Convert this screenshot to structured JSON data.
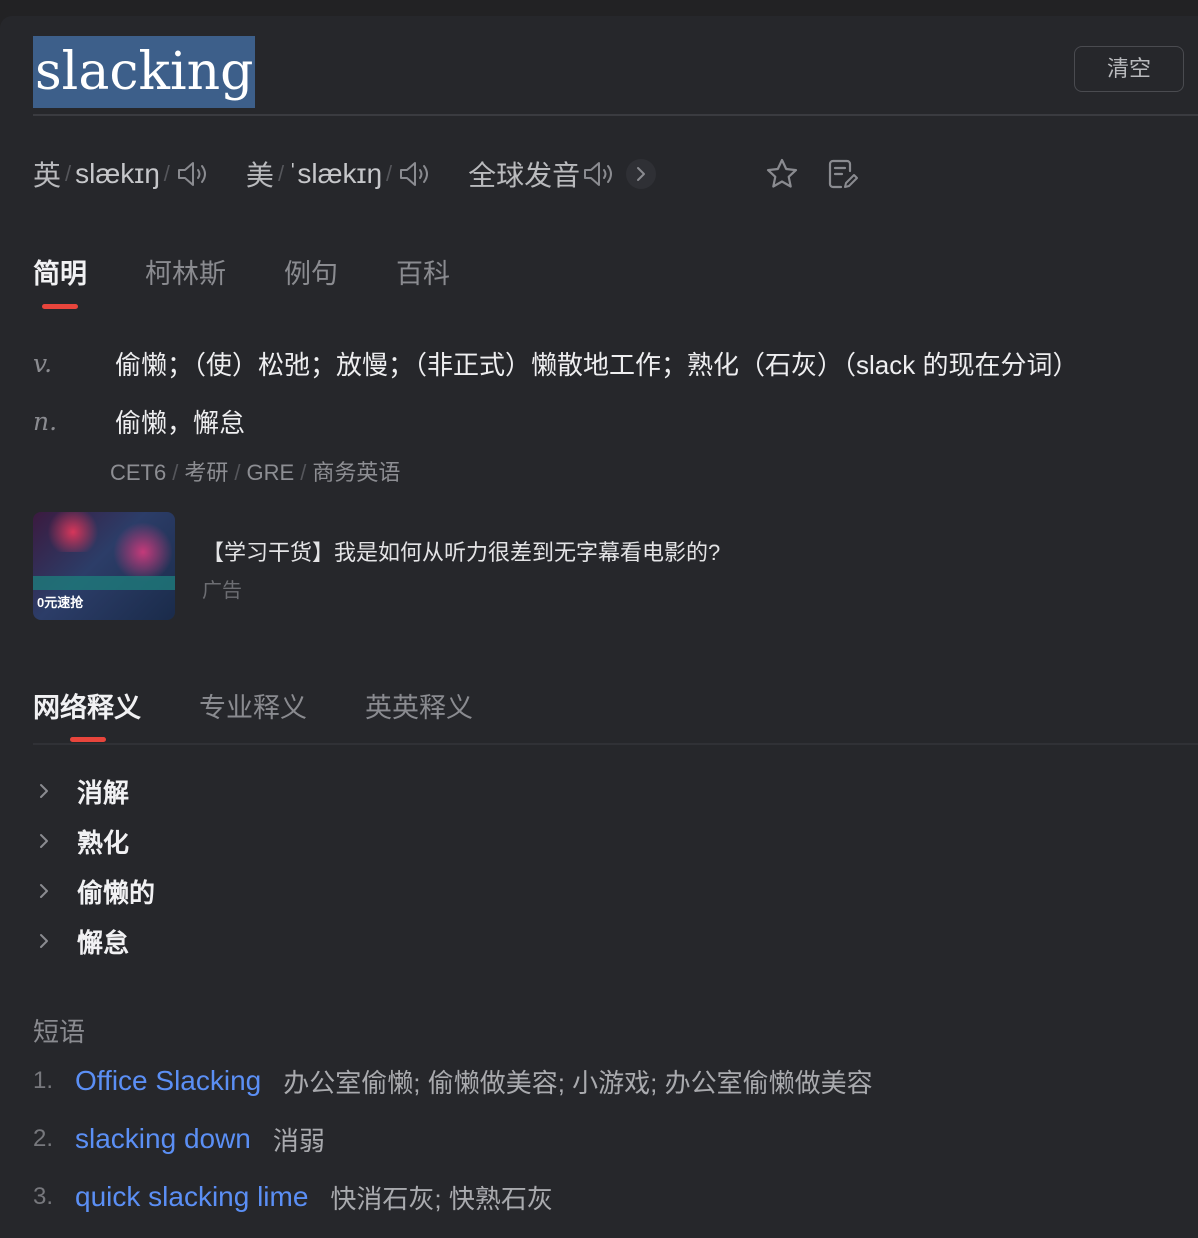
{
  "search": {
    "query": "slacking",
    "clear_label": "清空"
  },
  "pronunciation": {
    "uk_label": "英",
    "uk_phonetic": "slækɪŋ",
    "us_label": "美",
    "us_phonetic": "ˈslækɪŋ",
    "global_label": "全球发音",
    "sep": "/"
  },
  "tabs": [
    "简明",
    "柯林斯",
    "例句",
    "百科"
  ],
  "definitions": [
    {
      "pos": "v.",
      "meaning": "偷懒；（使）松弛；放慢；（非正式）懒散地工作；熟化（石灰）（slack 的现在分词）"
    },
    {
      "pos": "n.",
      "meaning": "偷懒，懈怠"
    }
  ],
  "exam_tags": [
    "CET6",
    "考研",
    "GRE",
    "商务英语"
  ],
  "ad": {
    "title": "【学习干货】我是如何从听力很差到无字幕看电影的?",
    "label": "广告",
    "thumb_text": "0元速抢"
  },
  "net_tabs": [
    "网络释义",
    "专业释义",
    "英英释义"
  ],
  "net_meanings": [
    "消解",
    "熟化",
    "偷懒的",
    "懈怠"
  ],
  "phrases_heading": "短语",
  "phrases": [
    {
      "num": "1.",
      "en": "Office Slacking",
      "zh": "办公室偷懒; 偷懒做美容; 小游戏; 办公室偷懒做美容"
    },
    {
      "num": "2.",
      "en": "slacking down",
      "zh": "消弱"
    },
    {
      "num": "3.",
      "en": "quick slacking lime",
      "zh": "快消石灰; 快熟石灰"
    }
  ],
  "colors": {
    "background": "#26272b",
    "accent_red": "#e8453c",
    "link_blue": "#5b8ff5",
    "selection": "#3d5f8a"
  }
}
